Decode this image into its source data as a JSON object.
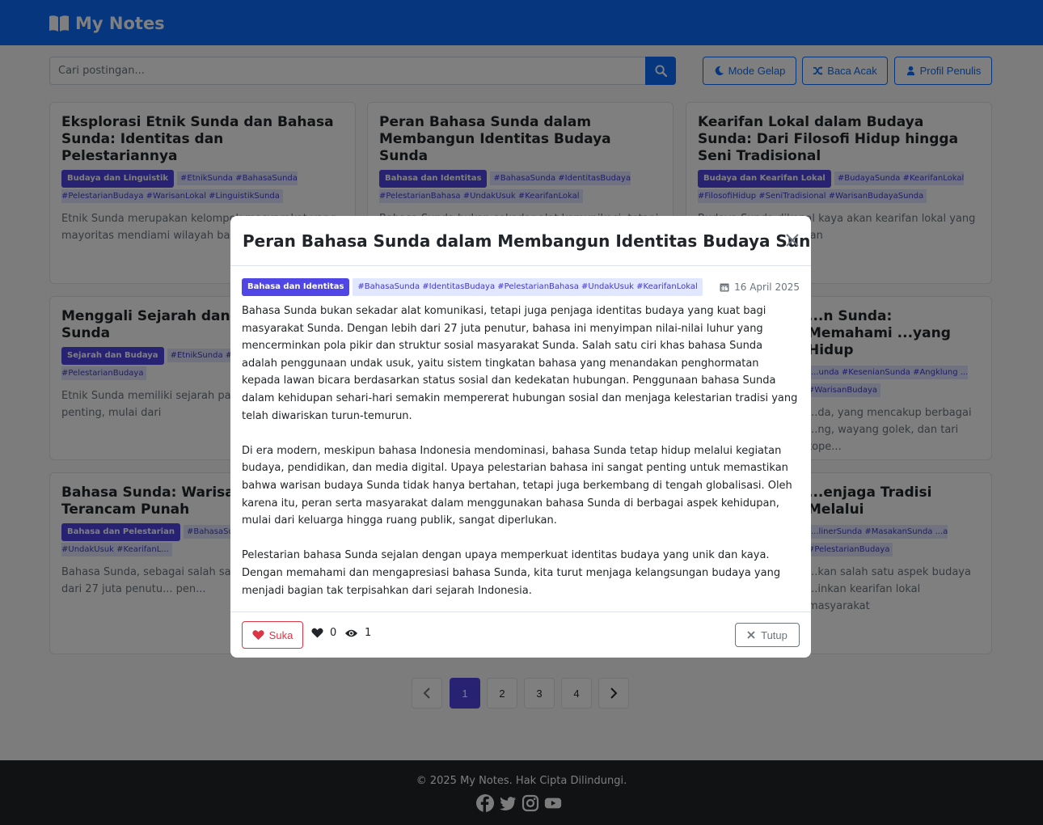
{
  "nav": {
    "brand": "My Notes",
    "brand_icon": "book-open-icon"
  },
  "toolbar": {
    "search_placeholder": "Cari postingan...",
    "dark_mode": "Mode Gelap",
    "random": "Baca Acak",
    "profile": "Profil Penulis"
  },
  "posts": [
    {
      "title": "Eksplorasi Etnik Sunda dan Bahasa Sunda: Identitas dan Pelestariannya",
      "category": "Budaya dan Linguistik",
      "tags": "#EtnikSunda #BahasaSunda #PelestarianBudaya #WarisanLokal #LinguistikSunda",
      "excerpt": "Etnik Sunda merupakan kelompok masyarakat yang mayoritas mendiami wilayah bara...",
      "excerpt_tail": "..."
    },
    {
      "title": "Peran Bahasa Sunda dalam Membangun Identitas Budaya Sunda",
      "category": "Bahasa dan Identitas",
      "tags": "#BahasaSunda #IdentitasBudaya #PelestarianBahasa #UndakUsuk #KearifanLokal",
      "excerpt": "Bahasa Sunda bukan sekadar alat komunikasi, tetapi"
    },
    {
      "title": "Kearifan Lokal dalam Budaya Sunda: Dari Filosofi Hidup hingga Seni Tradisional",
      "category": "Budaya dan Kearifan Lokal",
      "tags": "#BudayaSunda #KearifanLokal #FilosofiHidup #SeniTradisional #WarisanBudayaSunda",
      "excerpt": "Budaya Sunda dikenal kaya akan kearifan lokal yang ...agai aspek kehidupan"
    },
    {
      "title": "Menggali Sejarah dan Per... Etnik Sunda",
      "category": "Sejarah dan Budaya",
      "tags": "#EtnikSunda #Seja... #BudayaSunda #PelestarianBudaya",
      "excerpt": "Etnik Sunda memiliki sejarah pan... berbagai era penting, mulai dari"
    },
    {
      "title": "...n Sunda: Memahami ...yang Hidup",
      "category": "",
      "tags": "...unda #KesenianSunda #Angklung ... #WarisanBudaya",
      "excerpt": "...da, yang mencakup berbagai ...ng, wayang golek, dan tari tope..."
    },
    {
      "title": "Bahasa Sunda: Warisan Li... Terancam Punah",
      "category": "Bahasa dan Pelestarian",
      "tags": "#BahasaSunda ... #WarisanLinguistik #UndakUsuk #KearifanL...",
      "excerpt": "Bahasa Sunda, sebagai salah satu... dengan lebih dari 27 juta penutu... pen..."
    },
    {
      "title": "...enjaga Tradisi Melalui",
      "category": "",
      "tags": "...linerSunda #MasakanSunda ...a #PelestarianBudaya",
      "excerpt": "...kan salah satu aspek budaya ...inkan kearifan lokal masyarakat"
    }
  ],
  "pagination": {
    "pages": [
      "1",
      "2",
      "3",
      "4"
    ],
    "current": "1"
  },
  "footer": {
    "text": "© 2025 My Notes. Hak Cipta Dilindungi.",
    "socials": [
      "facebook-icon",
      "twitter-icon",
      "instagram-icon",
      "youtube-icon"
    ]
  },
  "modal": {
    "title": "Peran Bahasa Sunda dalam Membangun Identitas Budaya Sunda",
    "category": "Bahasa dan Identitas",
    "tags": "#BahasaSunda #IdentitasBudaya #PelestarianBahasa #UndakUsuk #KearifanLokal",
    "date": "16 April 2025",
    "paragraphs": [
      "Bahasa Sunda bukan sekadar alat komunikasi, tetapi juga penjaga identitas budaya yang kuat bagi masyarakat Sunda. Dengan lebih dari 27 juta penutur, bahasa ini menyimpan nilai-nilai luhur yang mencerminkan pola pikir dan struktur sosial masyarakat Sunda. Salah satu ciri khas bahasa Sunda adalah penggunaan undak usuk, yaitu sistem tingkatan bahasa yang menandakan penghormatan kepada lawan bicara berdasarkan status sosial dan kedekatan hubungan. Penggunaan bahasa Sunda dalam kehidupan sehari-hari semakin mempererat hubungan sosial dan menjaga kelestarian tradisi yang telah diwariskan turun-temurun.",
      "Di era modern, meskipun bahasa Indonesia mendominasi, bahasa Sunda tetap hidup melalui kegiatan budaya, pendidikan, dan media digital. Upaya pelestarian bahasa ini sangat penting untuk memastikan bahwa warisan budaya Sunda tidak hanya bertahan, tetapi juga berkembang di tengah globalisasi. Oleh karena itu, peran serta masyarakat dalam menggunakan bahasa Sunda di berbagai aspek kehidupan, mulai dari keluarga hingga ruang publik, sangat diperlukan.",
      "Pelestarian bahasa Sunda sejalan dengan upaya memperkuat identitas budaya yang unik dan kaya. Dengan memahami dan mengapresiasi bahasa Sunda, kita turut menjaga kelangsungan budaya yang menjadi bagian tak terpisahkan dari sejarah Indonesia."
    ],
    "like_label": "Suka",
    "likes": "0",
    "views": "1",
    "close_label": "Tutup"
  },
  "colors": {
    "primary": "#0d6efd",
    "accent": "#4f46e5",
    "tag_bg": "#e0e7ff",
    "like": "#dc3545",
    "footer": "#212529"
  }
}
